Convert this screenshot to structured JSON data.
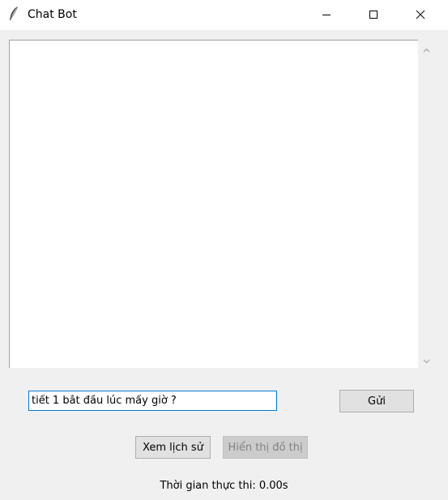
{
  "window": {
    "title": "Chat Bot",
    "icon": "feather-icon"
  },
  "window_controls": {
    "minimize_icon": "minimize-icon",
    "maximize_icon": "maximize-icon",
    "close_icon": "close-icon"
  },
  "chat": {
    "messages": []
  },
  "input": {
    "value": "tiết 1 bắt đầu lúc mấy giờ ?",
    "focus_border_color": "#0078d7"
  },
  "buttons": {
    "send_label": "Gửi",
    "history_label": "Xem lịch sử",
    "graph_label": "Hiển thị đồ thị",
    "graph_disabled": true
  },
  "status": {
    "execution_time": "Thời gian thực thi: 0.00s"
  }
}
